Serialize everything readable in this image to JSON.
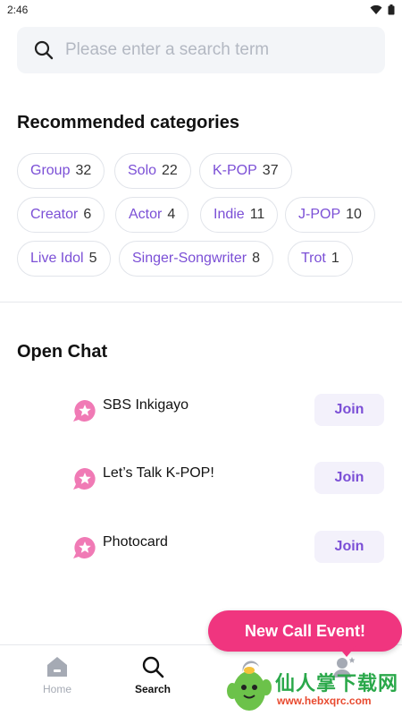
{
  "status_bar": {
    "time": "2:46"
  },
  "search": {
    "placeholder": "Please enter a search term"
  },
  "recommended": {
    "title": "Recommended categories",
    "chips": [
      {
        "name": "Group",
        "count": "32"
      },
      {
        "name": "Solo",
        "count": "22"
      },
      {
        "name": "K-POP",
        "count": "37"
      },
      {
        "name": "Creator",
        "count": "6"
      },
      {
        "name": "Actor",
        "count": "4"
      },
      {
        "name": "Indie",
        "count": "11"
      },
      {
        "name": "J-POP",
        "count": "10"
      },
      {
        "name": "Live Idol",
        "count": "5"
      },
      {
        "name": "Singer-Songwriter",
        "count": "8"
      },
      {
        "name": "Trot",
        "count": "1"
      }
    ]
  },
  "open_chat": {
    "title": "Open Chat",
    "rooms": [
      {
        "name": "SBS Inkigayo",
        "join_label": "Join"
      },
      {
        "name": "Let’s Talk K-POP!",
        "join_label": "Join"
      },
      {
        "name": "Photocard",
        "join_label": "Join"
      }
    ]
  },
  "promo": {
    "label": "New Call Event!"
  },
  "bottom_nav": {
    "items": [
      {
        "label": "Home",
        "icon": "home-icon"
      },
      {
        "label": "Search",
        "icon": "search-icon"
      }
    ]
  },
  "watermark": {
    "text": "仙人掌下载网",
    "url": "www.hebxqrc.com"
  },
  "colors": {
    "accent": "#7b4fd6",
    "promo": "#f0357f",
    "chip_border": "#e1e4ea",
    "search_bg": "#f3f5f8"
  }
}
